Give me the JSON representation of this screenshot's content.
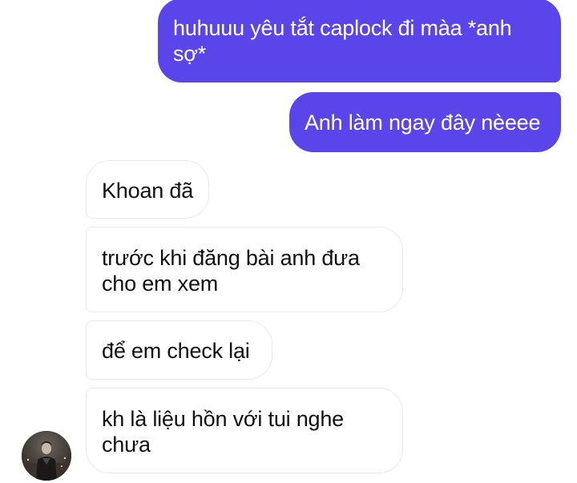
{
  "conversation": {
    "messages": [
      {
        "direction": "sent",
        "text": "huhuuu yêu tắt caplock đi màa *anh sợ*"
      },
      {
        "direction": "sent",
        "text": "Anh làm ngay đây nèeee"
      },
      {
        "direction": "received",
        "text": "Khoan đã"
      },
      {
        "direction": "received",
        "text": "trước khi đăng bài anh đưa cho em xem"
      },
      {
        "direction": "received",
        "text": "để em check lại"
      },
      {
        "direction": "received",
        "text": "kh là liệu hồn với tui nghe chưa"
      }
    ],
    "contact": {
      "avatar_icon": "contact-avatar"
    }
  },
  "colors": {
    "sent_bubble": "#5a45eb",
    "sent_text": "#ffffff",
    "received_bubble": "#ffffff",
    "received_border": "#e9e9e9",
    "received_text": "#111111"
  }
}
